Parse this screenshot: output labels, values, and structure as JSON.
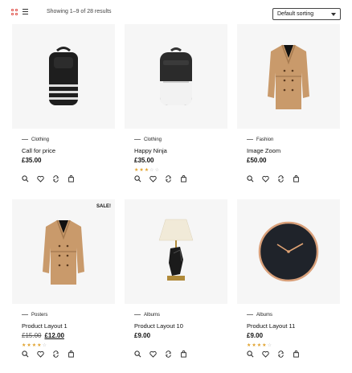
{
  "toolbar": {
    "results_text": "Showing 1–9 of 28 results",
    "sort_selected": "Default sorting",
    "grid_icon": "grid-view-icon",
    "list_icon": "list-view-icon",
    "accent": "#e0564f"
  },
  "rating_color": "#e0a12c",
  "products": [
    {
      "category": "Clothing",
      "title": "Call for price",
      "price": "£35.00",
      "rating": 0,
      "image": "backpack-black-striped",
      "sale": ""
    },
    {
      "category": "Clothing",
      "title": "Happy Ninja",
      "price": "£35.00",
      "rating": 3,
      "image": "backpack-black-white",
      "sale": ""
    },
    {
      "category": "Fashion",
      "title": "Image Zoom",
      "price": "£50.00",
      "rating": 0,
      "image": "trench-coat",
      "sale": ""
    },
    {
      "category": "Posters",
      "title": "Product Layout 1",
      "price_old": "£15.00",
      "price": "£12.00",
      "rating": 4,
      "image": "trench-coat",
      "sale": "SALE!"
    },
    {
      "category": "Albums",
      "title": "Product Layout 10",
      "price": "£9.00",
      "rating": 0,
      "image": "table-lamp",
      "sale": ""
    },
    {
      "category": "Albums",
      "title": "Product Layout 11",
      "price": "£9.00",
      "rating": 4,
      "image": "wall-clock",
      "sale": ""
    }
  ],
  "action_icons": [
    "search-icon",
    "heart-icon",
    "compare-icon",
    "cart-icon"
  ]
}
